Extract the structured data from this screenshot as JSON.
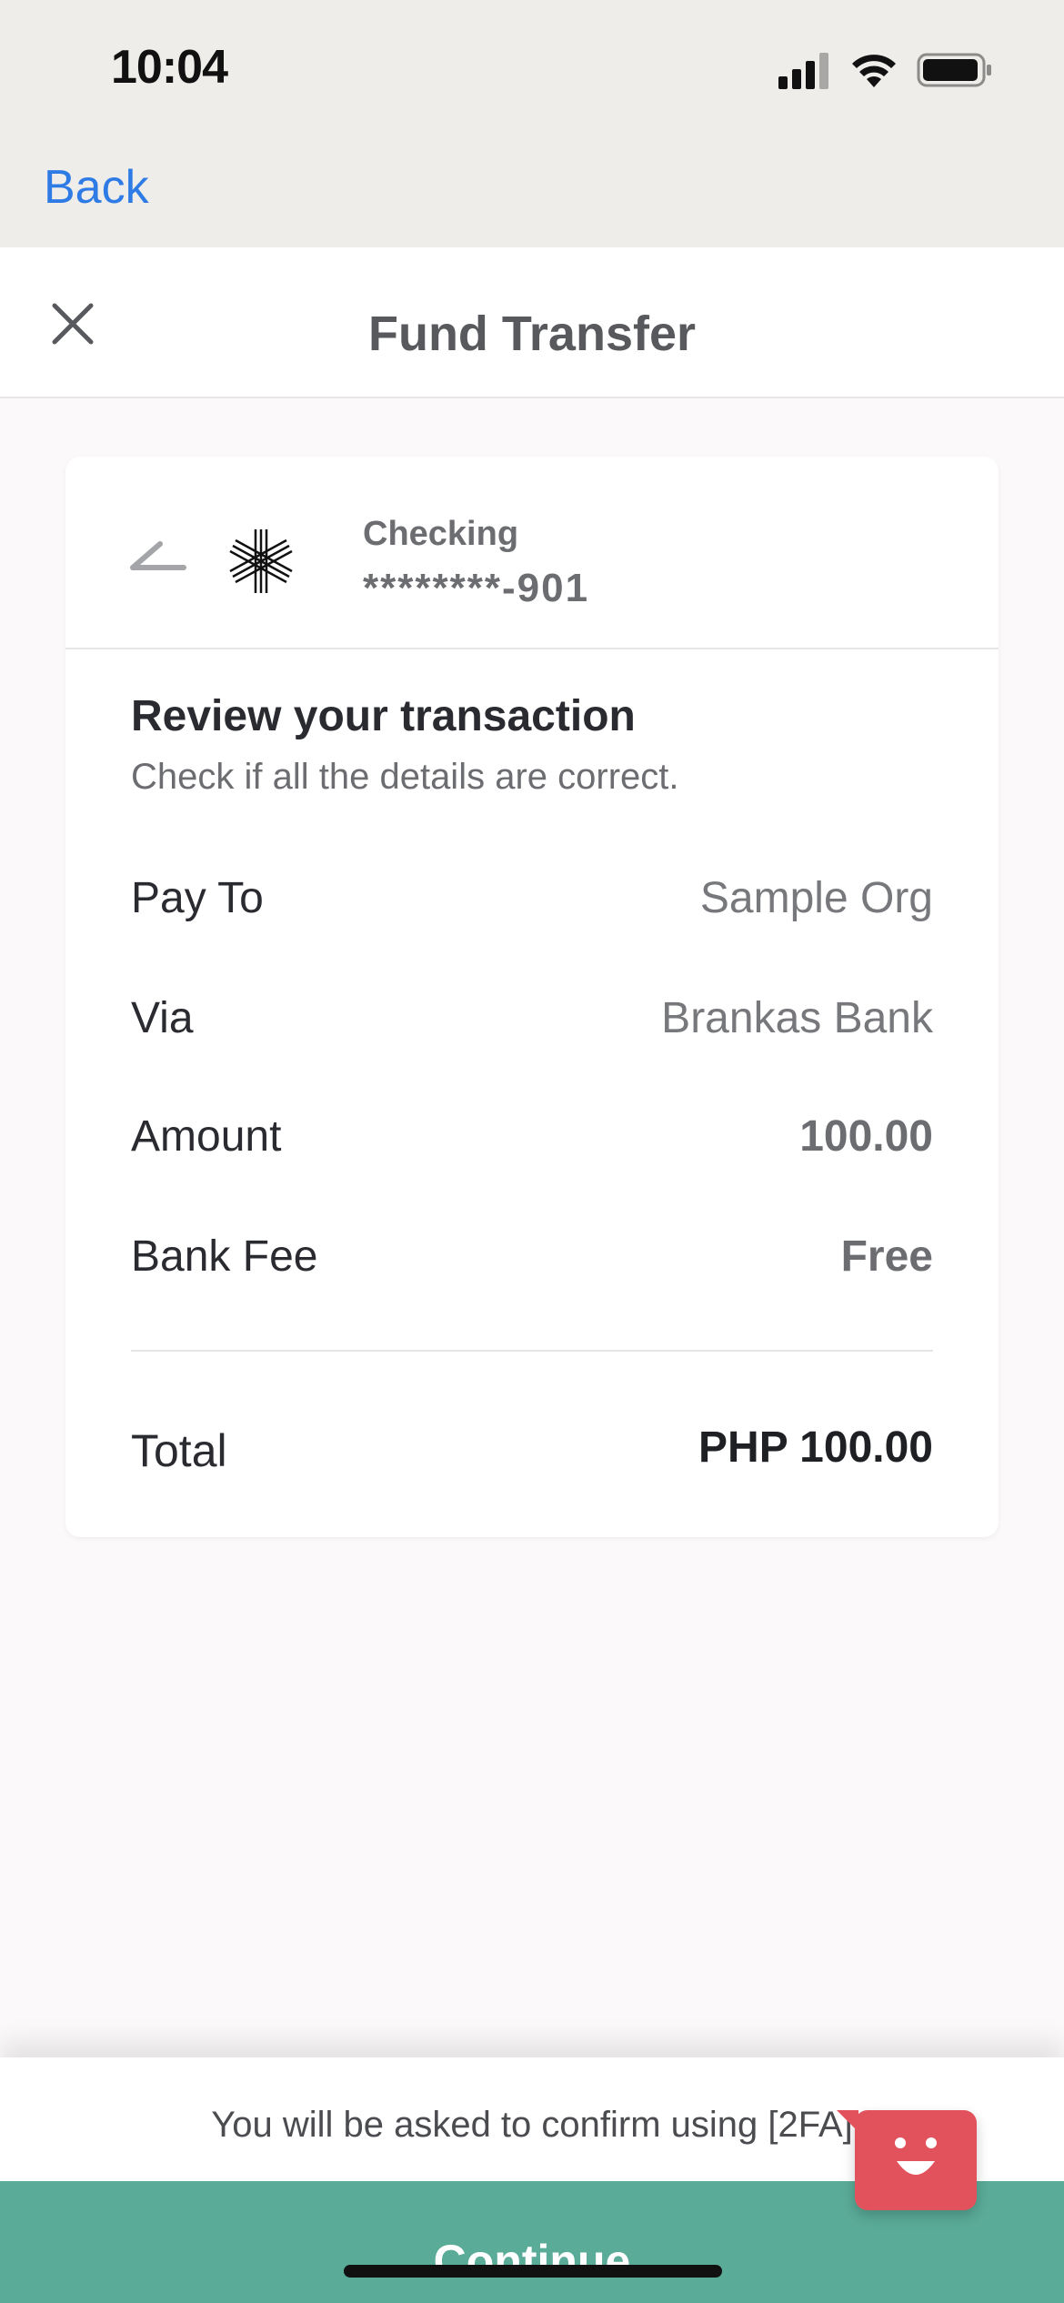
{
  "status_bar": {
    "time": "10:04"
  },
  "nav": {
    "back_label": "Back"
  },
  "header": {
    "title": "Fund Transfer"
  },
  "account": {
    "type": "Checking",
    "number": "********-901"
  },
  "review": {
    "title": "Review your transaction",
    "subtitle": "Check if all the details are correct."
  },
  "details": [
    {
      "label": "Pay To",
      "value": "Sample Org"
    },
    {
      "label": "Via",
      "value": "Brankas Bank"
    },
    {
      "label": "Amount",
      "value": "100.00"
    },
    {
      "label": "Bank Fee",
      "value": "Free"
    }
  ],
  "total": {
    "label": "Total",
    "value": "PHP 100.00"
  },
  "footer": {
    "confirm_note": "You will be asked to confirm using [2FA]",
    "continue_label": "Continue"
  },
  "colors": {
    "accent": "#5aab98",
    "link": "#2f7be5",
    "chat": "#e2525c"
  }
}
